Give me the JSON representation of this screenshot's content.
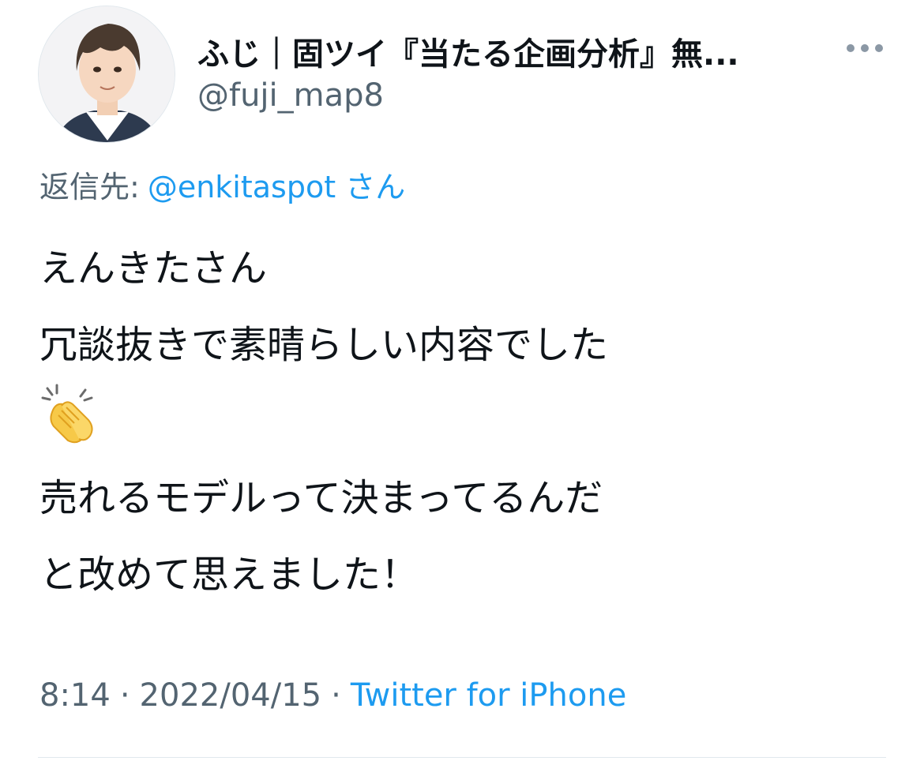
{
  "tweet": {
    "author": {
      "display_name": "ふじ｜固ツイ『当たる企画分析』無...",
      "handle": "@fuji_map8"
    },
    "reply_to": {
      "prefix": "返信先:",
      "mention": "@enkitaspot",
      "suffix": "さん"
    },
    "text_lines": [
      "えんきたさん",
      "冗談抜きで素晴らしい内容でした",
      "👏",
      "売れるモデルって決まってるんだ",
      "と改めて思えました！"
    ],
    "meta": {
      "time": "8:14",
      "date": "2022/04/15",
      "source": "Twitter for iPhone"
    },
    "icons": {
      "more": "more-horizontal-icon",
      "emoji": "clapping-hands-emoji"
    }
  }
}
